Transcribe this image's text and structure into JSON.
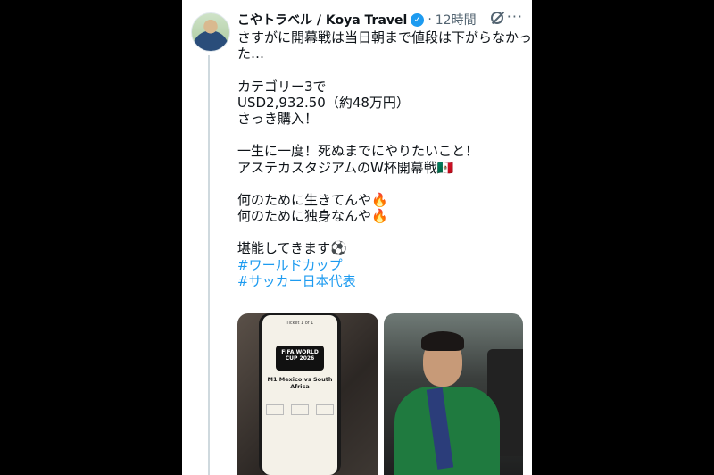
{
  "tweet": {
    "author_name": "こやトラベル / Koya Travel",
    "verified_icon": "verified-badge-icon",
    "separator": "·",
    "timestamp": "12時間",
    "more_label": "···",
    "lines": [
      "さすがに開幕戦は当日朝まで値段は下がらなかっ",
      "た…",
      "",
      "カテゴリー3で",
      "USD2,932.50（約48万円）",
      "さっき購入！",
      "",
      "一生に一度！死ぬまでにやりたいこと！",
      "アステカスタジアムのW杯開幕戦🇲🇽",
      "",
      "何のために生きてんや🔥",
      "何のために独身なんや🔥",
      "",
      "堪能してきます⚽"
    ],
    "hashtags": [
      "#ワールドカップ",
      "#サッカー日本代表"
    ]
  },
  "photos": {
    "left": {
      "ticket_header": "Ticket 1 of 1",
      "logo_text": "FIFA WORLD CUP 2026",
      "match": "M1 Mexico vs South Africa"
    }
  },
  "colors": {
    "link": "#1d9bf0",
    "text": "#0f1419",
    "muted": "#536471"
  }
}
